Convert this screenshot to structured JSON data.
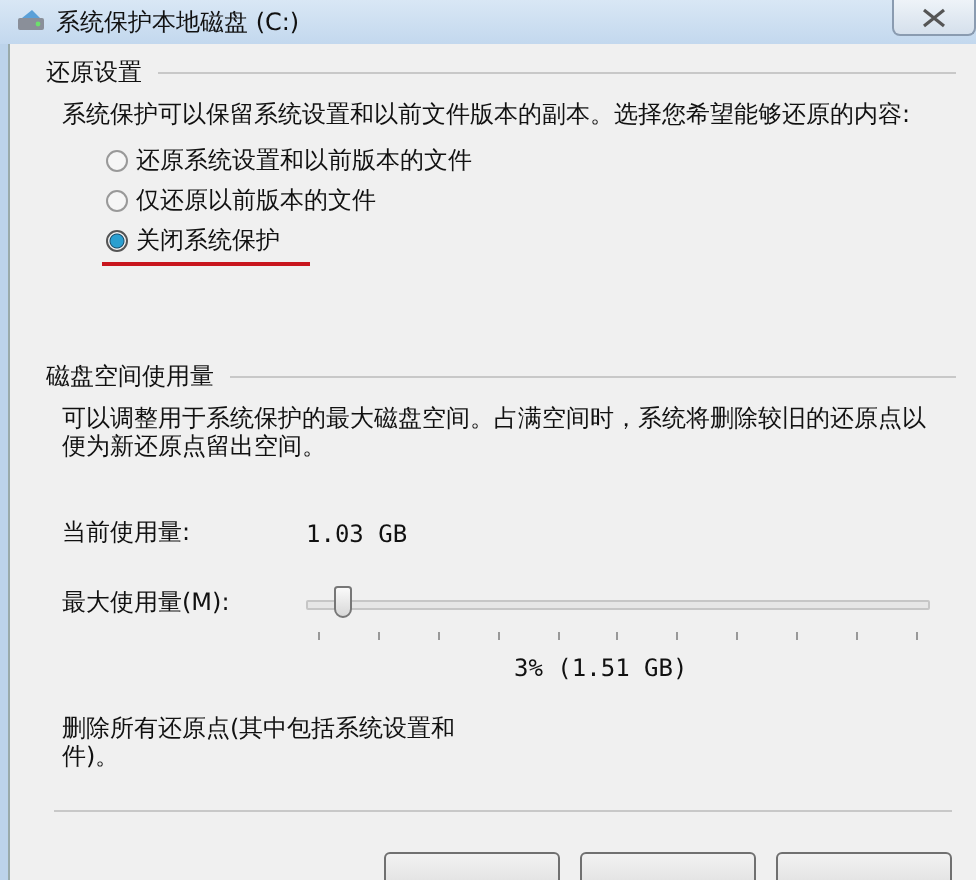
{
  "window": {
    "title": "系统保护本地磁盘 (C:)"
  },
  "restore_settings": {
    "heading": "还原设置",
    "description": "系统保护可以保留系统设置和以前文件版本的副本。选择您希望能够还原的内容:",
    "options": [
      {
        "label": "还原系统设置和以前版本的文件",
        "selected": false
      },
      {
        "label": "仅还原以前版本的文件",
        "selected": false
      },
      {
        "label": "关闭系统保护",
        "selected": true
      }
    ]
  },
  "disk_usage": {
    "heading": "磁盘空间使用量",
    "description": "可以调整用于系统保护的最大磁盘空间。占满空间时，系统将删除较旧的还原点以便为新还原点留出空间。",
    "current_label": "当前使用量:",
    "current_value": "1.03 GB",
    "max_label": "最大使用量(M):",
    "slider": {
      "level": 0.03
    },
    "max_reading": "3% (1.51 GB)",
    "delete_text": [
      "删除所有还原点(其中包括系统设置和",
      "件)。"
    ]
  }
}
